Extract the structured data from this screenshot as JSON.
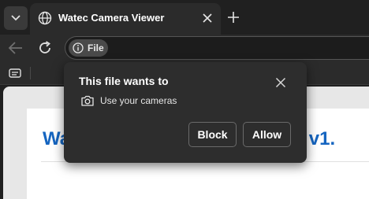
{
  "browser": {
    "tab": {
      "title": "Watec Camera Viewer",
      "icon": "globe-icon"
    },
    "toolbar": {
      "site_chip_label": "File"
    }
  },
  "page": {
    "heading_left": "Wa",
    "heading_right": "TC) v1."
  },
  "permission_prompt": {
    "title": "This file wants to",
    "permission": "Use your cameras",
    "block_label": "Block",
    "allow_label": "Allow"
  }
}
